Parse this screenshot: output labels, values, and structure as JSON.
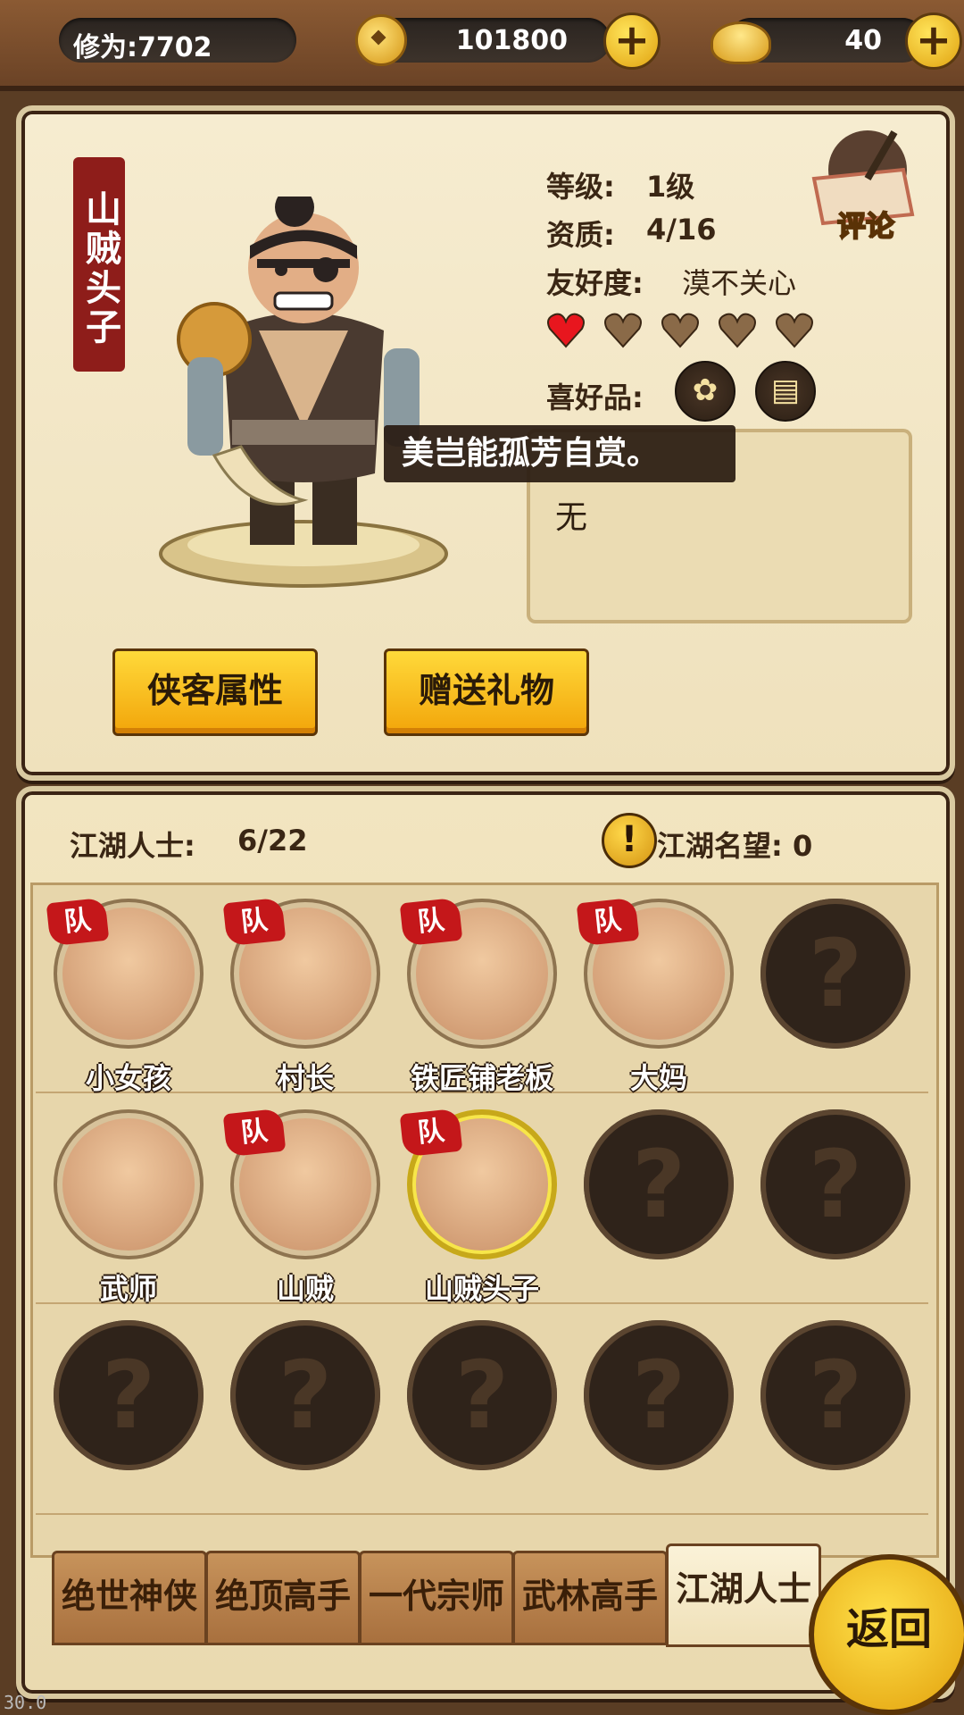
{
  "topbar": {
    "cultivation": "修为:7702",
    "coins": "101800",
    "gold": "40",
    "plus_symbol": "+"
  },
  "hero": {
    "name": "山贼头子",
    "level_label": "等级:",
    "level_value": "1级",
    "aptitude_label": "资质:",
    "aptitude_value": "4/16",
    "friendship_label": "友好度:",
    "friendship_value": "漠不关心",
    "hearts": {
      "filled": 1,
      "total": 5
    },
    "preferences_label": "喜好品:",
    "preference_icons": [
      "flower-icon",
      "scroll-icon"
    ],
    "comment_label": "评论",
    "tooltip": "美岂能孤芳自赏。",
    "description": "无",
    "attr_button": "侠客属性",
    "gift_button": "赠送礼物"
  },
  "roster": {
    "count_label": "江湖人士:",
    "count_value": "6/22",
    "fame_label": "江湖名望: 0",
    "team_badge": "队",
    "locked_symbol": "?",
    "rows": [
      [
        {
          "name": "小女孩",
          "team": true,
          "locked": false
        },
        {
          "name": "村长",
          "team": true,
          "locked": false
        },
        {
          "name": "铁匠铺老板",
          "team": true,
          "locked": false
        },
        {
          "name": "大妈",
          "team": true,
          "locked": false
        },
        {
          "name": "",
          "team": false,
          "locked": true
        }
      ],
      [
        {
          "name": "武师",
          "team": false,
          "locked": false
        },
        {
          "name": "山贼",
          "team": true,
          "locked": false
        },
        {
          "name": "山贼头子",
          "team": true,
          "locked": false,
          "selected": true
        },
        {
          "name": "",
          "team": false,
          "locked": true
        },
        {
          "name": "",
          "team": false,
          "locked": true
        }
      ],
      [
        {
          "name": "",
          "team": false,
          "locked": true
        },
        {
          "name": "",
          "team": false,
          "locked": true
        },
        {
          "name": "",
          "team": false,
          "locked": true
        },
        {
          "name": "",
          "team": false,
          "locked": true
        },
        {
          "name": "",
          "team": false,
          "locked": true
        }
      ]
    ]
  },
  "tabs": [
    "绝世神侠",
    "绝顶高手",
    "一代宗师",
    "武林高手",
    "江湖人士"
  ],
  "active_tab": 4,
  "back_button": "返回",
  "fps": "30.0",
  "colors": {
    "accent_yellow": "#ffd93a",
    "team_red": "#c4171a",
    "banner_red": "#8e1d1a"
  }
}
